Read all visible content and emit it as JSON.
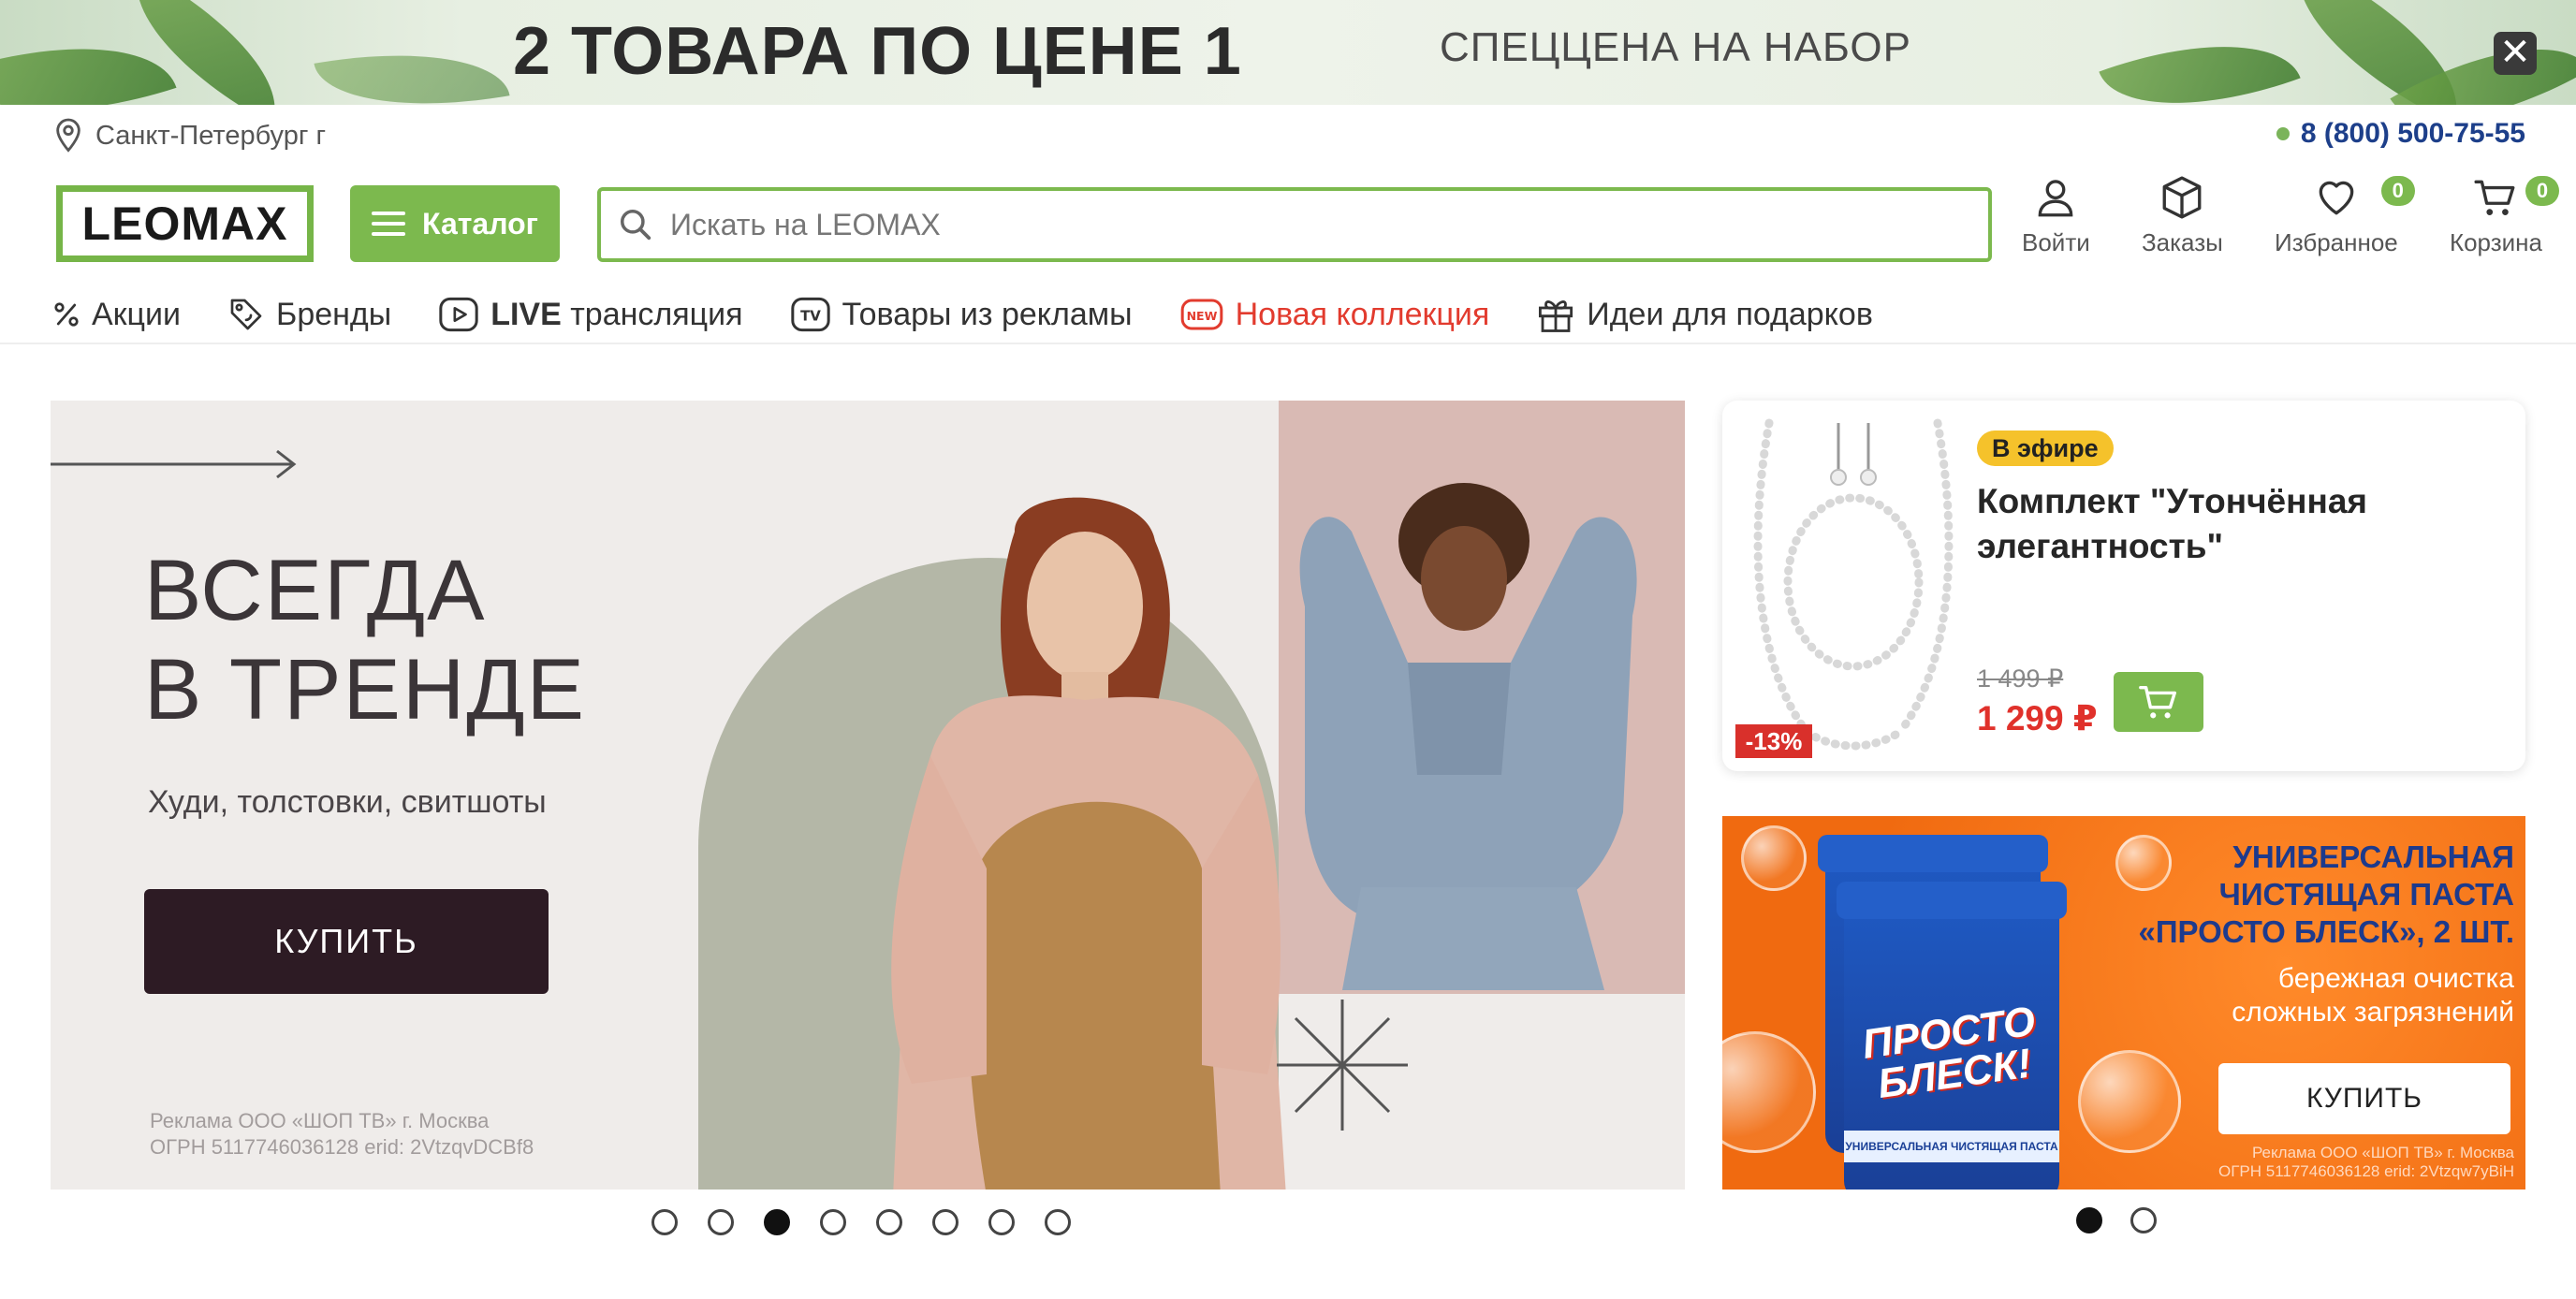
{
  "promo": {
    "title": "2 ТОВАРА ПО ЦЕНЕ 1",
    "subtitle": "СПЕЦЦЕНА НА НАБОР",
    "close_label": "✕"
  },
  "location": {
    "city": "Санкт-Петербург г"
  },
  "contact": {
    "phone": "8 (800) 500-75-55"
  },
  "header": {
    "logo": "LEOMAX",
    "catalog_label": "Каталог",
    "search_placeholder": "Искать на LEOMAX",
    "icons": {
      "login": "Войти",
      "orders": "Заказы",
      "favorites": "Избранное",
      "favorites_count": "0",
      "cart": "Корзина",
      "cart_count": "0"
    }
  },
  "nav": {
    "promotions": "Акции",
    "brands": "Бренды",
    "live_bold": "LIVE",
    "live_rest": "трансляция",
    "tv_goods": "Товары из рекламы",
    "new_collection": "Новая коллекция",
    "gifts": "Идеи для подарков",
    "new_badge": "NEW",
    "tv_badge": "TV"
  },
  "hero": {
    "title_line1": "ВСЕГДА",
    "title_line2": "В ТРЕНДЕ",
    "subtitle": "Худи, толстовки, свитшоты",
    "buy_label": "КУПИТЬ",
    "legal_line1": "Реклама ООО «ШОП ТВ» г. Москва",
    "legal_line2": "ОГРН 5117746036128 erid: 2VtzqvDCBf8",
    "slides_count": 8,
    "active_slide": 3
  },
  "live_product": {
    "badge": "В эфире",
    "title": "Комплект \"Утончённая элегантность\"",
    "old_price": "1 499 ₽",
    "new_price": "1 299 ₽",
    "discount": "-13%"
  },
  "side_ad": {
    "title_line1": "УНИВЕРСАЛЬНАЯ",
    "title_line2": "ЧИСТЯЩАЯ ПАСТА",
    "title_line3": "«ПРОСТО БЛЕСК», 2 ШТ.",
    "sub_line1": "бережная очистка",
    "sub_line2": "сложных загрязнений",
    "buy_label": "КУПИТЬ",
    "legal_line1": "Реклама ООО «ШОП ТВ» г. Москва",
    "legal_line2": "ОГРН 5117746036128 erid: 2Vtzqw7yBiH",
    "product_brand_line1": "ПРОСТО",
    "product_brand_line2": "БЛЕСК!",
    "product_band": "УНИВЕРСАЛЬНАЯ ЧИСТЯЩАЯ ПАСТА",
    "slides_count": 2,
    "active_slide": 1
  },
  "colors": {
    "brand_green": "#7cb94e",
    "phone_blue": "#1d3f8a",
    "sale_red": "#e0312b",
    "onair_yellow": "#f5c22b",
    "hero_button": "#2d1b24"
  }
}
